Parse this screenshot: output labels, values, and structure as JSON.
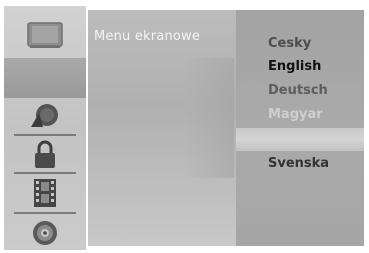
{
  "sidebar": {
    "items": [
      {
        "icon": "tv-screen-icon",
        "selected": false
      },
      {
        "icon": "blank-slot",
        "selected": true
      },
      {
        "icon": "audio-disc-icon",
        "selected": false
      },
      {
        "icon": "padlock-icon",
        "selected": false
      },
      {
        "icon": "film-strip-icon",
        "selected": false
      },
      {
        "icon": "dvd-disc-icon",
        "selected": false
      }
    ]
  },
  "main": {
    "title": "Menu ekranowe"
  },
  "submenu": {
    "languages": [
      {
        "label": "Cesky",
        "state": "normal"
      },
      {
        "label": "English",
        "state": "active"
      },
      {
        "label": "Deutsch",
        "state": "normal"
      },
      {
        "label": "Magyar",
        "state": "faded"
      },
      {
        "label": "",
        "state": "highlighted"
      },
      {
        "label": "Svenska",
        "state": "normal"
      }
    ]
  },
  "colors": {
    "selected_item": "#9a9a9a",
    "panel": "#b4b4b4",
    "submenu": "#a6a6a6",
    "active_text": "#111111"
  }
}
